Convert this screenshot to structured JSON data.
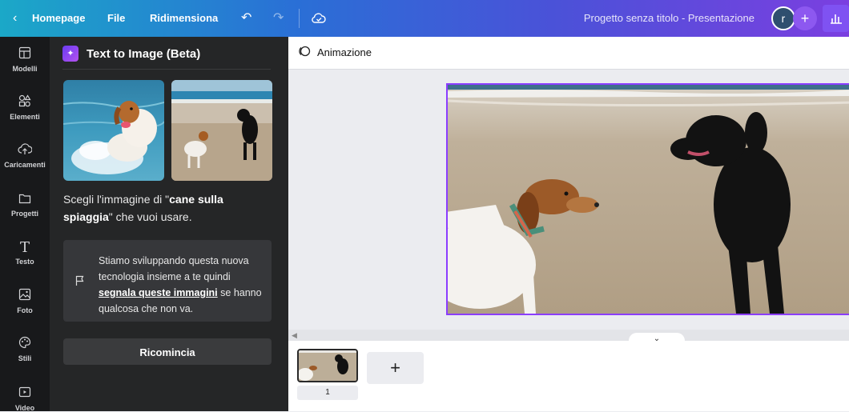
{
  "topbar": {
    "back_label": "Homepage",
    "file_label": "File",
    "resize_label": "Ridimensiona",
    "project_title": "Progetto senza titolo - Presentazione",
    "avatar_initial": "r",
    "plus": "+"
  },
  "rail": {
    "items": [
      {
        "label": "Modelli",
        "icon": "templates-icon"
      },
      {
        "label": "Elementi",
        "icon": "elements-icon"
      },
      {
        "label": "Caricamenti",
        "icon": "upload-icon"
      },
      {
        "label": "Progetti",
        "icon": "folder-icon"
      },
      {
        "label": "Testo",
        "icon": "text-icon"
      },
      {
        "label": "Foto",
        "icon": "photo-icon"
      },
      {
        "label": "Stili",
        "icon": "palette-icon"
      },
      {
        "label": "Video",
        "icon": "video-icon"
      }
    ]
  },
  "panel": {
    "title": "Text to Image (Beta)",
    "desc_prefix": "Scegli l'immagine di \"",
    "desc_query": "cane sulla spiaggia",
    "desc_suffix": "\" che vuoi usare.",
    "info_text_1": "Stiamo sviluppando questa nuova tecnologia insieme a te quindi ",
    "info_link": "segnala queste immagini",
    "info_text_2": " se hanno qualcosa che non va.",
    "restart_label": "Ricomincia"
  },
  "editor": {
    "animation_label": "Animazione",
    "page_number": "1",
    "add_page": "+"
  },
  "colors": {
    "accent": "#8b3dff",
    "panel_bg": "#252627",
    "rail_bg": "#18191b"
  }
}
